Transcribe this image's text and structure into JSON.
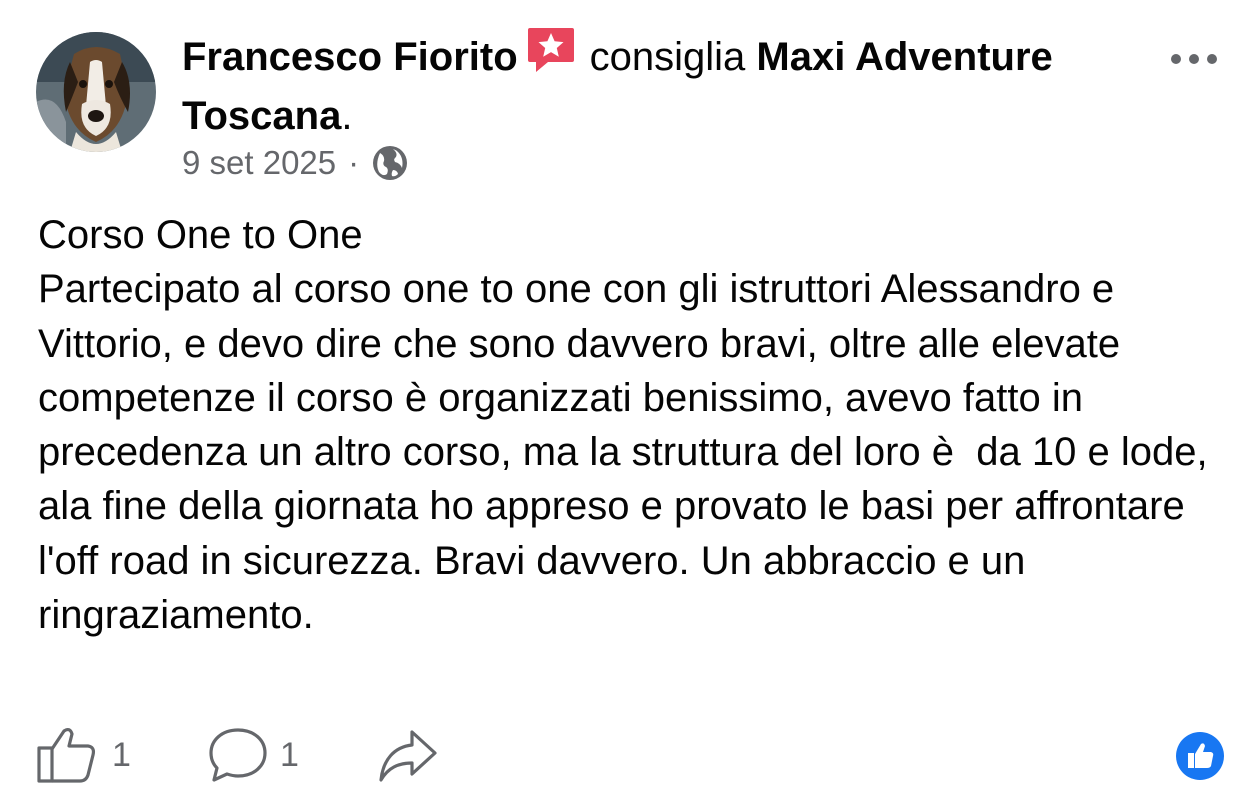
{
  "post": {
    "author": "Francesco Fiorito",
    "recommendation_icon": "recommend-star-icon",
    "verb": "consiglia",
    "page_name": "Maxi Adventure Toscana",
    "page_suffix": ".",
    "date": "9 set 2025",
    "separator": "·",
    "audience_icon": "globe-icon",
    "text": "Corso One to One\nPartecipato al corso one to one con gli istruttori Alessandro e Vittorio, e devo dire che sono davvero bravi, oltre alle elevate competenze il corso è organizzati benissimo, avevo fatto in precedenza un altro corso, ma la struttura del loro è  da 10 e lode, ala fine della giornata ho appreso e provato le basi per affrontare l'off road in sicurezza. Bravi davvero. Un abbraccio e un ringraziamento."
  },
  "actions": {
    "like_count": "1",
    "comment_count": "1"
  },
  "colors": {
    "text_primary": "#050505",
    "text_secondary": "#65676b",
    "accent_blue": "#1877f2",
    "recommend_red": "#e8455c"
  }
}
